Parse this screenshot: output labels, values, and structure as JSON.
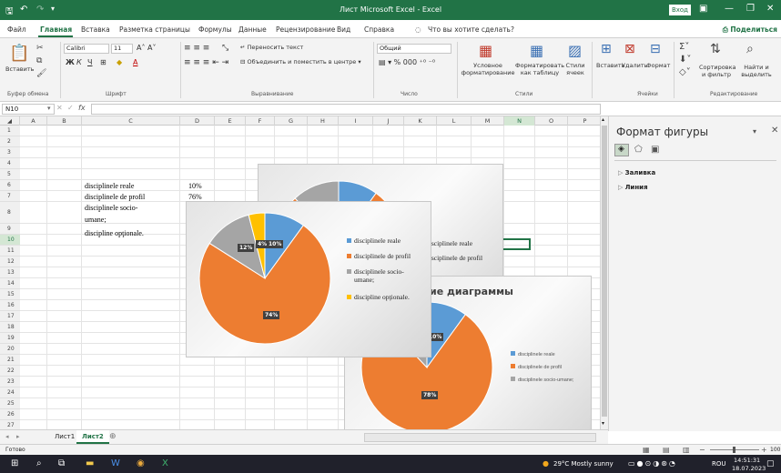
{
  "window": {
    "title": "Лист Microsoft Excel  -  Excel",
    "login": "Вход"
  },
  "menu": {
    "tabs": [
      "Файл",
      "Главная",
      "Вставка",
      "Разметка страницы",
      "Формулы",
      "Данные",
      "Рецензирование",
      "Вид",
      "Справка"
    ],
    "active_tab": "Главная",
    "tell_me": "Что вы хотите сделать?",
    "share": "Поделиться"
  },
  "ribbon": {
    "paste": "Вставить",
    "font_name": "Calibri",
    "font_size": "11",
    "wrap_text": "Переносить текст",
    "merge_center": "Объединить и поместить в центре",
    "number_format": "Общий",
    "conditional": "Условное форматирование",
    "format_table": "Форматировать как таблицу",
    "cell_styles": "Стили ячеек",
    "insert": "Вставить",
    "delete": "Удалить",
    "format": "Формат",
    "sort_filter": "Сортировка и фильтр",
    "find_select": "Найти и выделить",
    "groups": [
      "Буфер обмена",
      "Шрифт",
      "Выравнивание",
      "Число",
      "Стили",
      "Ячейки",
      "Редактирование"
    ]
  },
  "formula_bar": {
    "name_box": "N10",
    "fx": "fx",
    "value": ""
  },
  "grid": {
    "columns": [
      "A",
      "B",
      "C",
      "D",
      "E",
      "F",
      "G",
      "H",
      "I",
      "J",
      "K",
      "L",
      "M",
      "N",
      "O",
      "P"
    ],
    "selected_column": "N",
    "rows": [
      "1",
      "2",
      "3",
      "4",
      "5",
      "6",
      "7",
      "8",
      "9",
      "10",
      "11",
      "12",
      "13",
      "14",
      "15",
      "16",
      "17",
      "18",
      "19",
      "20",
      "21",
      "22",
      "23",
      "24",
      "25",
      "26",
      "27"
    ],
    "selected_row": "10",
    "cells": {
      "c6": "disciplinele reale",
      "d6": "10%",
      "c7": "disciplinele de profil",
      "d7": "76%",
      "c8a": "disciplinele socio-",
      "c8b": "umane;",
      "c9": "discipline opţionale."
    }
  },
  "chart_main": {
    "type": "pie",
    "title": "",
    "labels": [
      "disciplinele reale",
      "disciplinele de profil",
      "disciplinele socio-umane;",
      "discipline opţionale."
    ],
    "legend_lines": [
      [
        "disciplinele reale"
      ],
      [
        "disciplinele de profil"
      ],
      [
        "disciplinele socio-",
        "umane;"
      ],
      [
        "discipline opţionale."
      ]
    ],
    "values": [
      10,
      74,
      12,
      4
    ],
    "data_labels": [
      "10%",
      "74%",
      "12%",
      "4%"
    ],
    "colors": [
      "#5b9bd5",
      "#ed7d31",
      "#a5a5a5",
      "#ffc000"
    ],
    "legend_position": "right"
  },
  "chart_back": {
    "type": "pie",
    "title": "ание диаграммы",
    "labels": [
      "disciplinele reale",
      "disciplinele de profil",
      "disciplinele socio-umane;"
    ],
    "values": [
      10,
      78,
      12
    ],
    "data_labels": [
      "10%",
      "78%"
    ],
    "colors": [
      "#5b9bd5",
      "#ed7d31",
      "#a5a5a5"
    ],
    "legend_position": "right"
  },
  "chart_top_partial": {
    "legend_lines": [
      "disciplinele reale",
      "disciplinele de profil"
    ]
  },
  "chart_data": [
    {
      "type": "pie",
      "title": "",
      "categories": [
        "disciplinele reale",
        "disciplinele de profil",
        "disciplinele socio-umane;",
        "discipline opţionale."
      ],
      "values": [
        10,
        74,
        12,
        4
      ]
    },
    {
      "type": "pie",
      "title": "ание диаграммы",
      "categories": [
        "disciplinele reale",
        "disciplinele de profil",
        "disciplinele socio-umane;"
      ],
      "values": [
        10,
        78,
        12
      ]
    }
  ],
  "pane": {
    "title": "Формат фигуры",
    "sections": [
      "Заливка",
      "Линия"
    ]
  },
  "sheets": {
    "tabs": [
      "Лист1",
      "Лист2"
    ],
    "active": "Лист2"
  },
  "status": {
    "ready": "Готово",
    "zoom": "100"
  },
  "taskbar": {
    "weather": "29°C  Mostly sunny",
    "lang": "ROU",
    "time": "14:51:31",
    "date": "18.07.2023"
  }
}
